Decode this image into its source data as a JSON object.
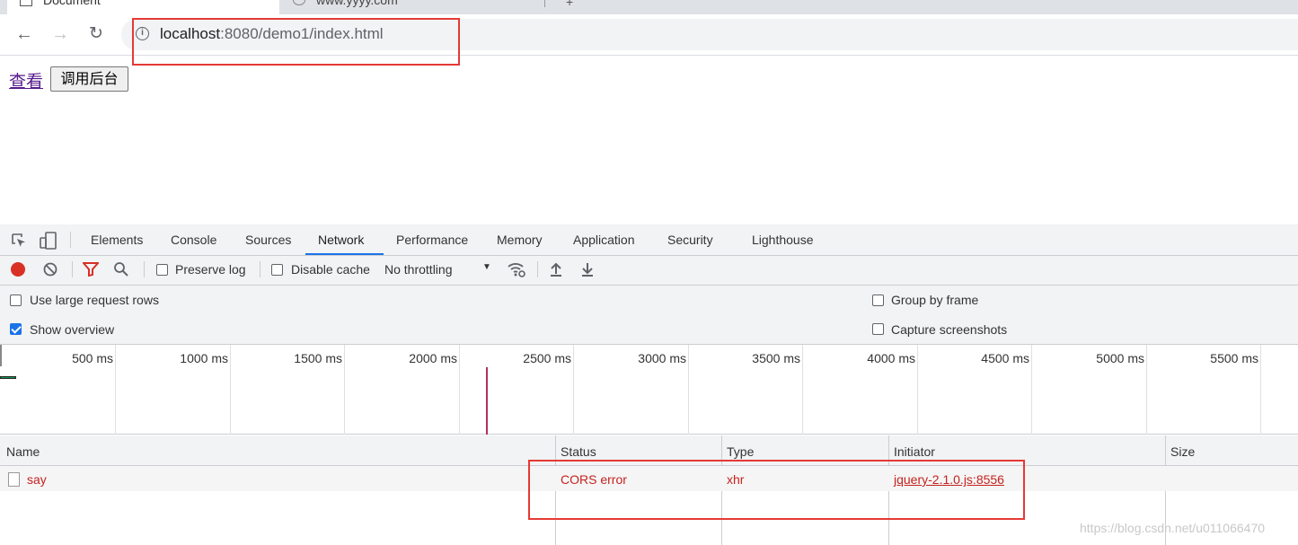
{
  "browser": {
    "tabs": [
      {
        "title": "Document"
      },
      {
        "title": "www.yyyy.com"
      }
    ],
    "url": {
      "host": "localhost",
      "rest": ":8080/demo1/index.html"
    }
  },
  "page": {
    "link_label": "查看",
    "button_label": "调用后台"
  },
  "devtools": {
    "tabs": [
      "Elements",
      "Console",
      "Sources",
      "Network",
      "Performance",
      "Memory",
      "Application",
      "Security",
      "Lighthouse"
    ],
    "active_tab": "Network",
    "toolbar": {
      "preserve_log": {
        "label": "Preserve log",
        "checked": false
      },
      "disable_cache": {
        "label": "Disable cache",
        "checked": false
      },
      "throttling": "No throttling"
    },
    "settings": {
      "large_rows": {
        "label": "Use large request rows",
        "checked": false
      },
      "show_overview": {
        "label": "Show overview",
        "checked": true
      },
      "group_by_frame": {
        "label": "Group by frame",
        "checked": false
      },
      "capture_screenshots": {
        "label": "Capture screenshots",
        "checked": false
      }
    },
    "overview_ticks": [
      "500 ms",
      "1000 ms",
      "1500 ms",
      "2000 ms",
      "2500 ms",
      "3000 ms",
      "3500 ms",
      "4000 ms",
      "4500 ms",
      "5000 ms",
      "5500 ms"
    ],
    "columns": [
      "Name",
      "Status",
      "Type",
      "Initiator",
      "Size"
    ],
    "requests": [
      {
        "name": "say",
        "status": "CORS error",
        "type": "xhr",
        "initiator": "jquery-2.1.0.js:8556"
      }
    ]
  },
  "watermark": "https://blog.csdn.net/u011066470",
  "colors": {
    "error": "#c5221f",
    "annotation": "#e53935",
    "accent": "#1a73e8"
  }
}
